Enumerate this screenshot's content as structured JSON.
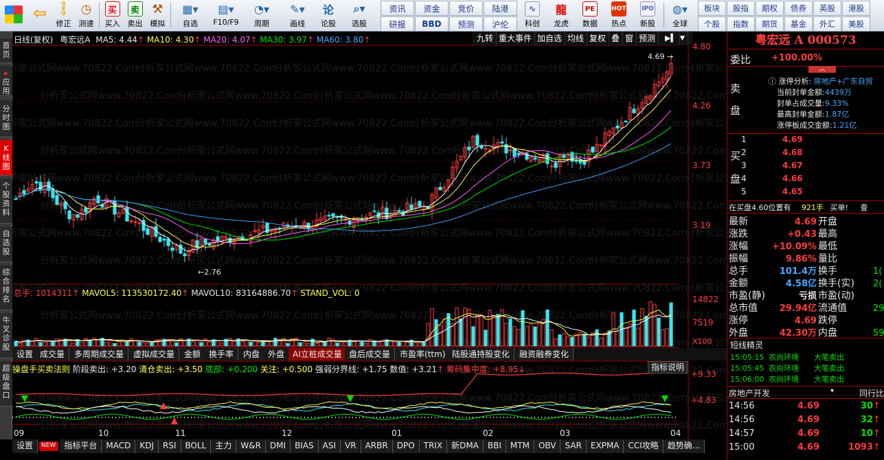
{
  "toolbar": {
    "buttons": [
      {
        "label": "修正",
        "icon": "up-arrow-icon"
      },
      {
        "label": "测速",
        "icon": "stopwatch-icon"
      },
      {
        "label": "买入",
        "icon": "buy-icon"
      },
      {
        "label": "卖出",
        "icon": "sell-icon"
      },
      {
        "label": "模拟",
        "icon": "gavel-icon"
      },
      {
        "label": "自选",
        "icon": "folder-icon"
      },
      {
        "label": "F10/F9",
        "icon": "f10-icon"
      },
      {
        "label": "周期",
        "icon": "clock-icon"
      },
      {
        "label": "画线",
        "icon": "pencil-icon"
      },
      {
        "label": "论股",
        "icon": "talk-icon"
      },
      {
        "label": "选股",
        "icon": "magnifier-icon"
      }
    ],
    "grid1": [
      "资讯",
      "资金",
      "竞价",
      "陆港",
      "研报",
      "BBD",
      "预测",
      "沪伦"
    ],
    "buttons2": [
      {
        "label": "科创",
        "icon": "chart-icon"
      },
      {
        "label": "龙虎",
        "icon": "dragon-icon"
      },
      {
        "label": "数据",
        "icon": "pe-icon"
      },
      {
        "label": "热点",
        "icon": "hot-icon"
      },
      {
        "label": "新股",
        "icon": "ipo-icon"
      },
      {
        "label": "全球",
        "icon": "globe-icon"
      }
    ],
    "grid2": [
      "板块",
      "股指",
      "期权",
      "债券",
      "英股",
      "港股",
      "个股",
      "指数",
      "期货",
      "基金",
      "外汇",
      "美股"
    ]
  },
  "left_tabs": [
    "首页",
    "应用",
    "分时图",
    "K线图",
    "个股资料",
    "自选股",
    "综合排名",
    "牛叉诊股",
    "超级盘口"
  ],
  "chart_header": {
    "title": "日线(复权)",
    "name": "粤宏远A",
    "ma5": "MA5: 4.44",
    "ma10": "MA10: 4.30",
    "ma20": "MA20: 4.07",
    "ma30": "MA30: 3.97",
    "ma60": "MA60: 3.80"
  },
  "chart_tabs": [
    "九转",
    "重大事件",
    "加自选",
    "均线",
    "复权",
    "叠",
    "窗",
    "预测"
  ],
  "price_axis": [
    "4.80",
    "4.26",
    "3.73",
    "3.19"
  ],
  "price_labels": {
    "high": "4.69",
    "low": "2.76"
  },
  "watermark": "分析家公式网www.70822.Com",
  "volume_header": {
    "total": "总手: 1014311",
    "mavol5": "MAVOL5: 113530172.40",
    "mavol10": "MAVOL10: 83164886.70",
    "stand": "STAND_VOL: 0"
  },
  "volume_axis": [
    "14822",
    "7519",
    "X100"
  ],
  "sub_tabs": [
    "设置",
    "成交量",
    "多周期成交量",
    "虚拟成交量",
    "金额",
    "换手率",
    "内盘",
    "外盘",
    "AI立桩成交量",
    "盘后成交量",
    "市盈率(ttm)",
    "陆股通持股变化",
    "融资融券变化"
  ],
  "indicator_header": {
    "name": "操盘手买卖法则",
    "items": [
      "阶段卖出: +3.20",
      "清仓卖出: +3.50",
      "底部: +0.200",
      "关注: +0.500",
      "强弱分界线: +1.75",
      "数值: +3.21",
      "筹码集中度: +8.95"
    ],
    "help": "指标说明"
  },
  "indicator_axis": [
    "+9.33",
    "+4.83"
  ],
  "months": [
    "09",
    "10",
    "11",
    "12",
    "01",
    "02",
    "03",
    "04"
  ],
  "bottom_tabs": [
    "设置",
    "NEW",
    "指标平台",
    "MACD",
    "KDJ",
    "RSI",
    "BOLL",
    "主力",
    "W&R",
    "DMI",
    "BIAS",
    "ASI",
    "VR",
    "ARBR",
    "DPO",
    "TRIX",
    "新DMA",
    "BBI",
    "MTM",
    "OBV",
    "SAR",
    "EXPMA",
    "CCI攻略",
    "趋势确..."
  ],
  "quote": {
    "title": "粤宏远 A  000573",
    "weibi_label": "委比",
    "weibi_value": "+100.00%",
    "analysis": {
      "label": "涨停分析:",
      "sector": "房地产+广东自贸",
      "lines": [
        {
          "k": "当前封单金额:",
          "v": "4439万"
        },
        {
          "k": "封单占成交量:",
          "v": "9.33%"
        },
        {
          "k": "最高封单金额:",
          "v": "1.87亿"
        },
        {
          "k": "涨停板成交金额:",
          "v": "1.21亿"
        }
      ]
    },
    "sell_label1": "卖",
    "sell_label2": "盘",
    "buy_label1": "买",
    "buy_label2": "盘",
    "bids": [
      {
        "n": "1",
        "p": "4.69"
      },
      {
        "n": "2",
        "p": "4.68"
      },
      {
        "n": "3",
        "p": "4.67"
      },
      {
        "n": "4",
        "p": "4.66"
      },
      {
        "n": "5",
        "p": "4.65"
      }
    ],
    "buy_notice": {
      "text": "在买盘4.60位置有",
      "qty": "921手",
      "act": "买单!",
      "more": "查"
    },
    "stats_left": [
      {
        "k": "最新",
        "v": "4.69"
      },
      {
        "k": "涨跌",
        "v": "+0.43"
      },
      {
        "k": "涨幅",
        "v": "+10.09%"
      },
      {
        "k": "振幅",
        "v": "9.86%"
      },
      {
        "k": "总手",
        "v": "101.4万"
      },
      {
        "k": "金额",
        "v": "4.58亿"
      },
      {
        "k": "市盈(静)",
        "v": "亏损"
      },
      {
        "k": "总市值",
        "v": "29.94亿"
      },
      {
        "k": "涨停",
        "v": "4.69"
      },
      {
        "k": "外盘",
        "v": "42.30万"
      }
    ],
    "stats_right": [
      {
        "k": "开盘",
        "v": ""
      },
      {
        "k": "最高",
        "v": ""
      },
      {
        "k": "最低",
        "v": ""
      },
      {
        "k": "量比",
        "v": ""
      },
      {
        "k": "换手",
        "v": "1("
      },
      {
        "k": "换手(实)",
        "v": "2("
      },
      {
        "k": "市盈(动)",
        "v": ""
      },
      {
        "k": "流通值",
        "v": "29"
      },
      {
        "k": "跌停",
        "v": ""
      },
      {
        "k": "内盘",
        "v": "59"
      }
    ],
    "elf_label": "短线精灵",
    "elf": [
      {
        "t": "15:05:15",
        "n": "农尚环境",
        "a": "大笔卖出"
      },
      {
        "t": "15:05:45",
        "n": "农尚环境",
        "a": "大笔卖出"
      },
      {
        "t": "15:06:00",
        "n": "农尚环境",
        "a": "大笔卖出"
      }
    ],
    "sector_label": "房地产开发",
    "sector_right": "同行比",
    "ticks": [
      {
        "t": "14:56",
        "p": "4.69",
        "v": "30"
      },
      {
        "t": "14:56",
        "p": "4.69",
        "v": "32"
      },
      {
        "t": "14:57",
        "p": "4.69",
        "v": "10"
      },
      {
        "t": "15:00",
        "p": "4.69",
        "v": "1093"
      }
    ]
  },
  "chart_data": {
    "type": "candlestick",
    "ylim": [
      2.6,
      4.85
    ],
    "x_tick_labels": [
      "09",
      "10",
      "11",
      "12",
      "01",
      "02",
      "03",
      "04"
    ],
    "low_annotation": 2.76,
    "high_annotation": 4.69
  }
}
